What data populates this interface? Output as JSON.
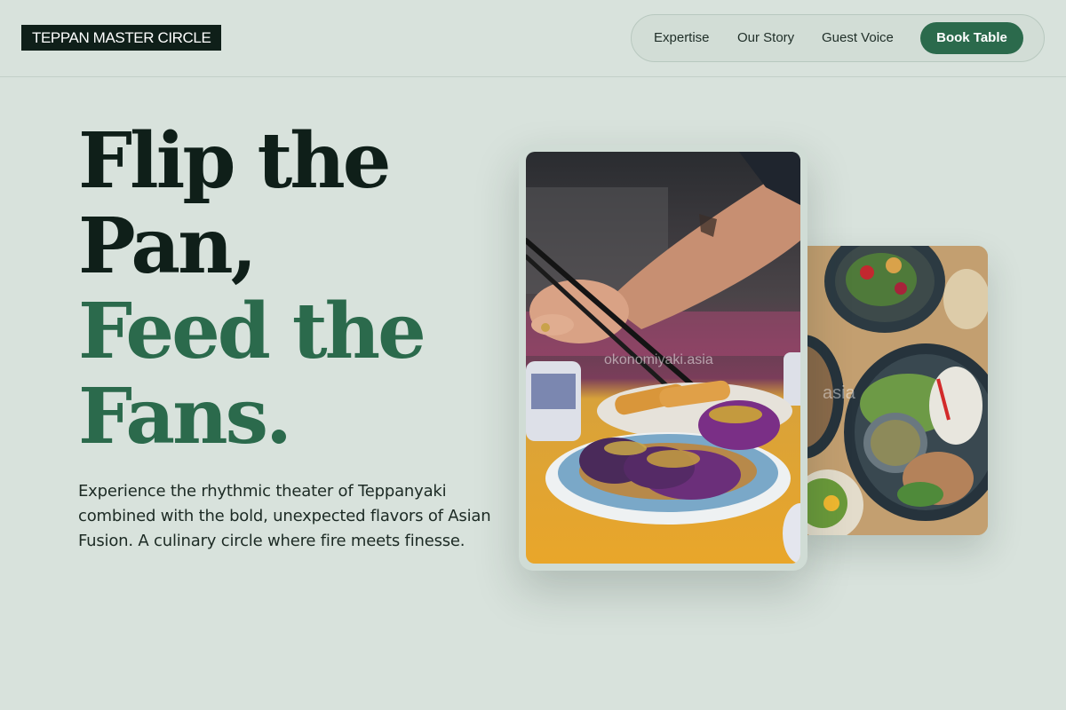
{
  "header": {
    "logo": "TEPPAN MASTER CIRCLE",
    "nav": [
      "Expertise",
      "Our Story",
      "Guest Voice"
    ],
    "cta": "Book Table"
  },
  "hero": {
    "title_lines_dark": [
      "Flip the",
      "Pan,"
    ],
    "title_lines_green": [
      "Feed the",
      "Fans."
    ],
    "description": "Experience the rhythmic theater of Teppanyaki combined with the bold, unexpected flavors of Asian Fusion. A culinary circle where fire meets finesse."
  },
  "images": {
    "main_watermark": "okonomiyaki.asia",
    "side_watermark": "asia"
  },
  "colors": {
    "background": "#d8e2dc",
    "accent": "#2b6a4c",
    "dark": "#0f1f19"
  }
}
